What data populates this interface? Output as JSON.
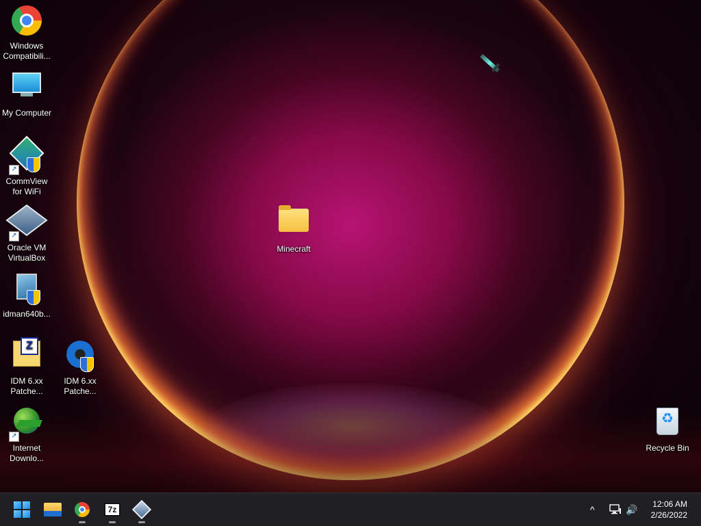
{
  "desktop": {
    "icons": {
      "chrome": "Windows Compatibili...",
      "my_computer": "My Computer",
      "commview": "CommView for WiFi",
      "virtualbox": "Oracle VM VirtualBox",
      "idman": "idman640b...",
      "idm_patch_1": "IDM 6.xx Patche...",
      "idm_patch_2": "IDM 6.xx Patche...",
      "internet_download": "Internet Downlo...",
      "minecraft": "Minecraft",
      "recycle_bin": "Recycle Bin"
    },
    "icon_names": [
      "chrome-icon",
      "computer-icon",
      "wifi-icon",
      "virtualbox-icon",
      "installer-icon",
      "zip-folder-icon",
      "gear-icon",
      "idm-icon",
      "folder-icon",
      "recycle-bin-icon"
    ]
  },
  "taskbar": {
    "apps": [
      "start",
      "file-explorer",
      "chrome",
      "7-zip",
      "virtualbox"
    ],
    "tray": {
      "chevron": "^",
      "volume": "🔊"
    },
    "clock": {
      "time": "12:06 AM",
      "date": "2/26/2022"
    }
  },
  "colors": {
    "taskbar": "#202024",
    "wallpaper_core": "#be1478",
    "ring_edge": "#ffb030"
  }
}
